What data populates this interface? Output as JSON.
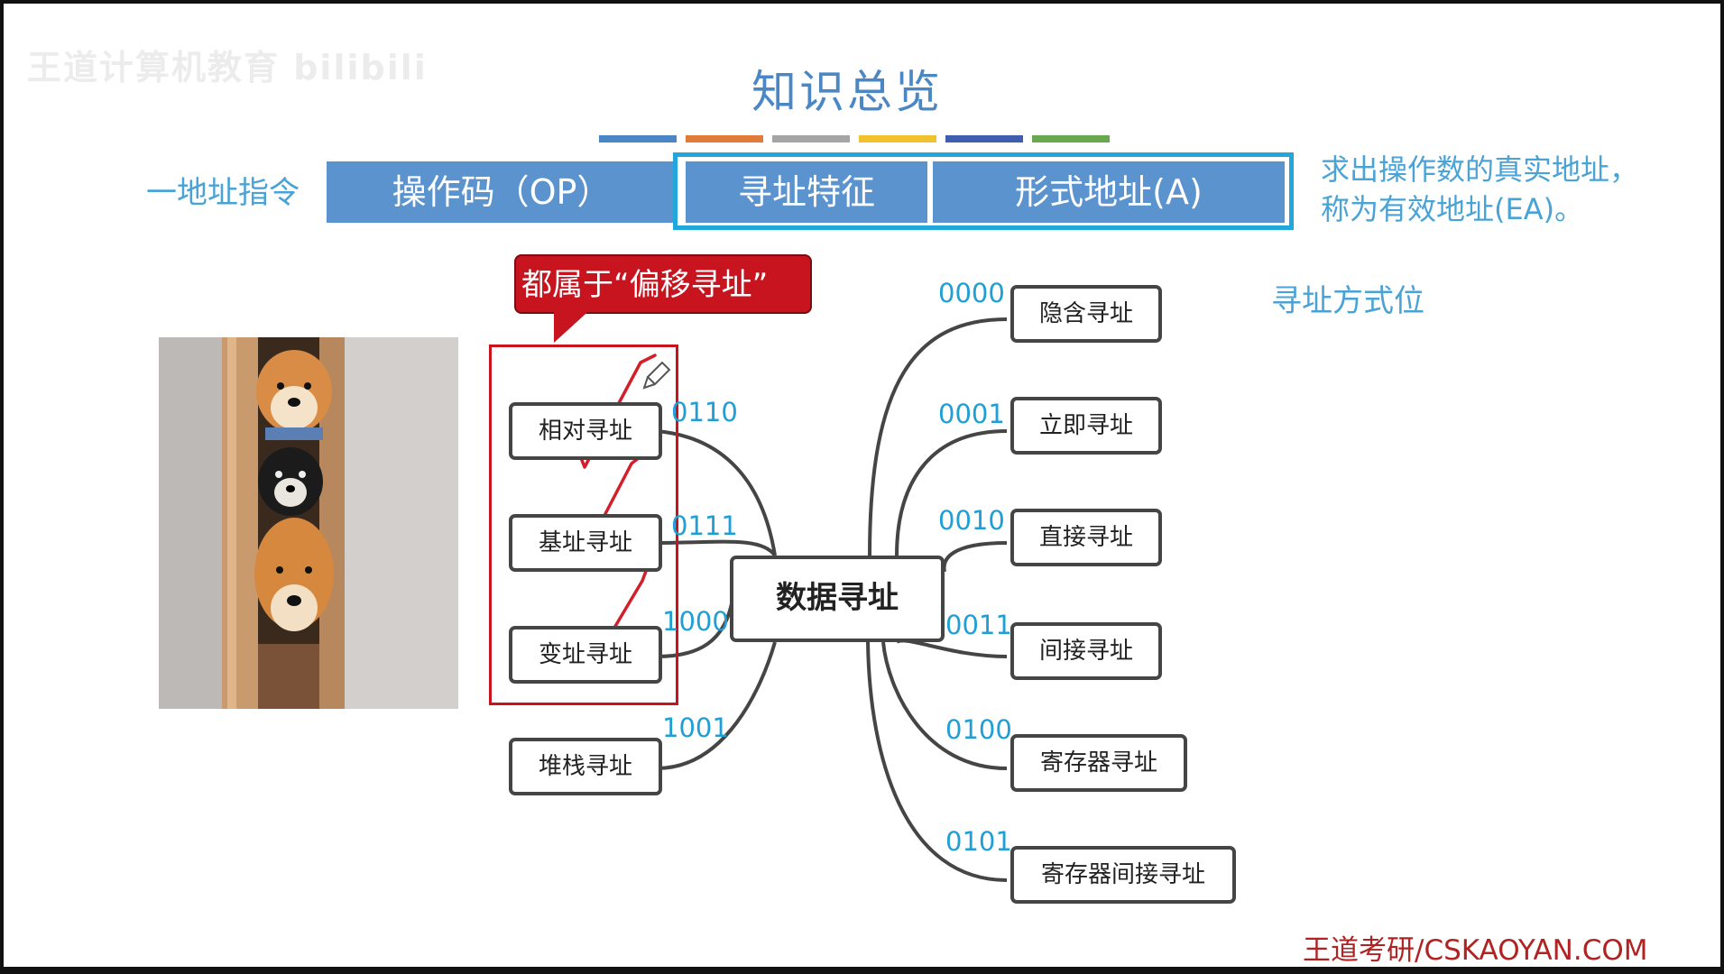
{
  "watermark": "王道计算机教育 bilibili",
  "title": "知识总览",
  "color_bars": [
    "#4a86c5",
    "#e07b39",
    "#a5a5a5",
    "#f2c12e",
    "#3f5fae",
    "#6aa84f"
  ],
  "instruction": {
    "label": "一地址指令",
    "fields": {
      "opcode": "操作码（OP）",
      "mode": "寻址特征",
      "address": "形式地址(A)"
    }
  },
  "note": {
    "line1": "求出操作数的真实地址，",
    "line2": "称为有效地址(EA)。"
  },
  "mode_bits_label": "寻址方式位",
  "callout": "都属于“偏移寻址”",
  "mindmap": {
    "center": "数据寻址",
    "left": [
      {
        "code": "0110",
        "label": "相对寻址"
      },
      {
        "code": "0111",
        "label": "基址寻址"
      },
      {
        "code": "1000",
        "label": "变址寻址"
      },
      {
        "code": "1001",
        "label": "堆栈寻址"
      }
    ],
    "right": [
      {
        "code": "0000",
        "label": "隐含寻址"
      },
      {
        "code": "0001",
        "label": "立即寻址"
      },
      {
        "code": "0010",
        "label": "直接寻址"
      },
      {
        "code": "0011",
        "label": "间接寻址"
      },
      {
        "code": "0100",
        "label": "寄存器寻址"
      },
      {
        "code": "0101",
        "label": "寄存器间接寻址"
      }
    ]
  },
  "footer": "王道考研/CSKAOYAN.COM",
  "colors": {
    "accent": "#4a87c4",
    "code": "#1f9fd6",
    "highlight": "#c8141f",
    "field": "#5b93cf"
  }
}
